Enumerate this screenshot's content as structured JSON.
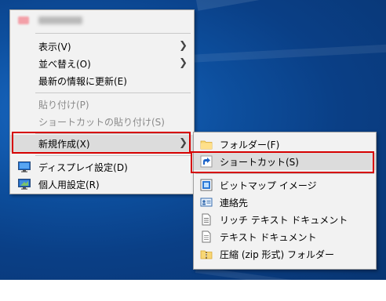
{
  "main_menu": {
    "header_label": "",
    "items": [
      {
        "label": "表示(V)"
      },
      {
        "label": "並べ替え(O)"
      },
      {
        "label": "最新の情報に更新(E)"
      },
      {
        "label": "貼り付け(P)"
      },
      {
        "label": "ショートカットの貼り付け(S)"
      },
      {
        "label": "新規作成(X)"
      },
      {
        "label": "ディスプレイ設定(D)"
      },
      {
        "label": "個人用設定(R)"
      }
    ]
  },
  "sub_menu": {
    "items": [
      {
        "label": "フォルダー(F)"
      },
      {
        "label": "ショートカット(S)"
      },
      {
        "label": "ビットマップ イメージ"
      },
      {
        "label": "連絡先"
      },
      {
        "label": "リッチ テキスト ドキュメント"
      },
      {
        "label": "テキスト ドキュメント"
      },
      {
        "label": "圧縮 (zip 形式) フォルダー"
      }
    ]
  },
  "colors": {
    "highlight_box": "#d60000",
    "menu_bg": "#f2f2f2",
    "desktop": "#0d4f9e"
  }
}
